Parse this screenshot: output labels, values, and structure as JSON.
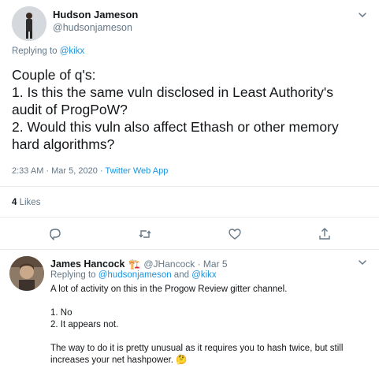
{
  "main_tweet": {
    "author_name": "Hudson Jameson",
    "author_handle": "@hudsonjameson",
    "replying_prefix": "Replying to ",
    "replying_to": "@kikx",
    "lines": [
      "Couple of q's:",
      "1. Is this the same vuln disclosed in Least Authority's",
      "audit of ProgPoW?",
      "2. Would this vuln also affect Ethash or other memory",
      "hard algorithms?"
    ],
    "timestamp": "2:33 AM · Mar 5, 2020 · ",
    "source": "Twitter Web App",
    "likes_count": "4",
    "likes_label": " Likes"
  },
  "reply_tweet": {
    "author_name": "James Hancock",
    "author_emoji": "🏗️",
    "author_handle": "@JHancock",
    "date": " · Mar 5",
    "replying_prefix": "Replying to ",
    "replying_to_1": "@hudsonjameson",
    "replying_and": " and ",
    "replying_to_2": "@kikx",
    "lines": [
      "A lot of activity on this in the Progow Review gitter channel.",
      "1. No",
      "2. It appears not.",
      "The way to do it is pretty unusual as it requires you to hash twice, but still",
      "increases your net hashpower. 🤔"
    ]
  },
  "icons": {
    "more": "chevron-down-icon",
    "reply": "reply-icon",
    "retweet": "retweet-icon",
    "like": "heart-icon",
    "share": "share-icon"
  },
  "colors": {
    "link": "#1b95e0",
    "secondary_text": "#657786",
    "divider": "#e6ecf0"
  }
}
